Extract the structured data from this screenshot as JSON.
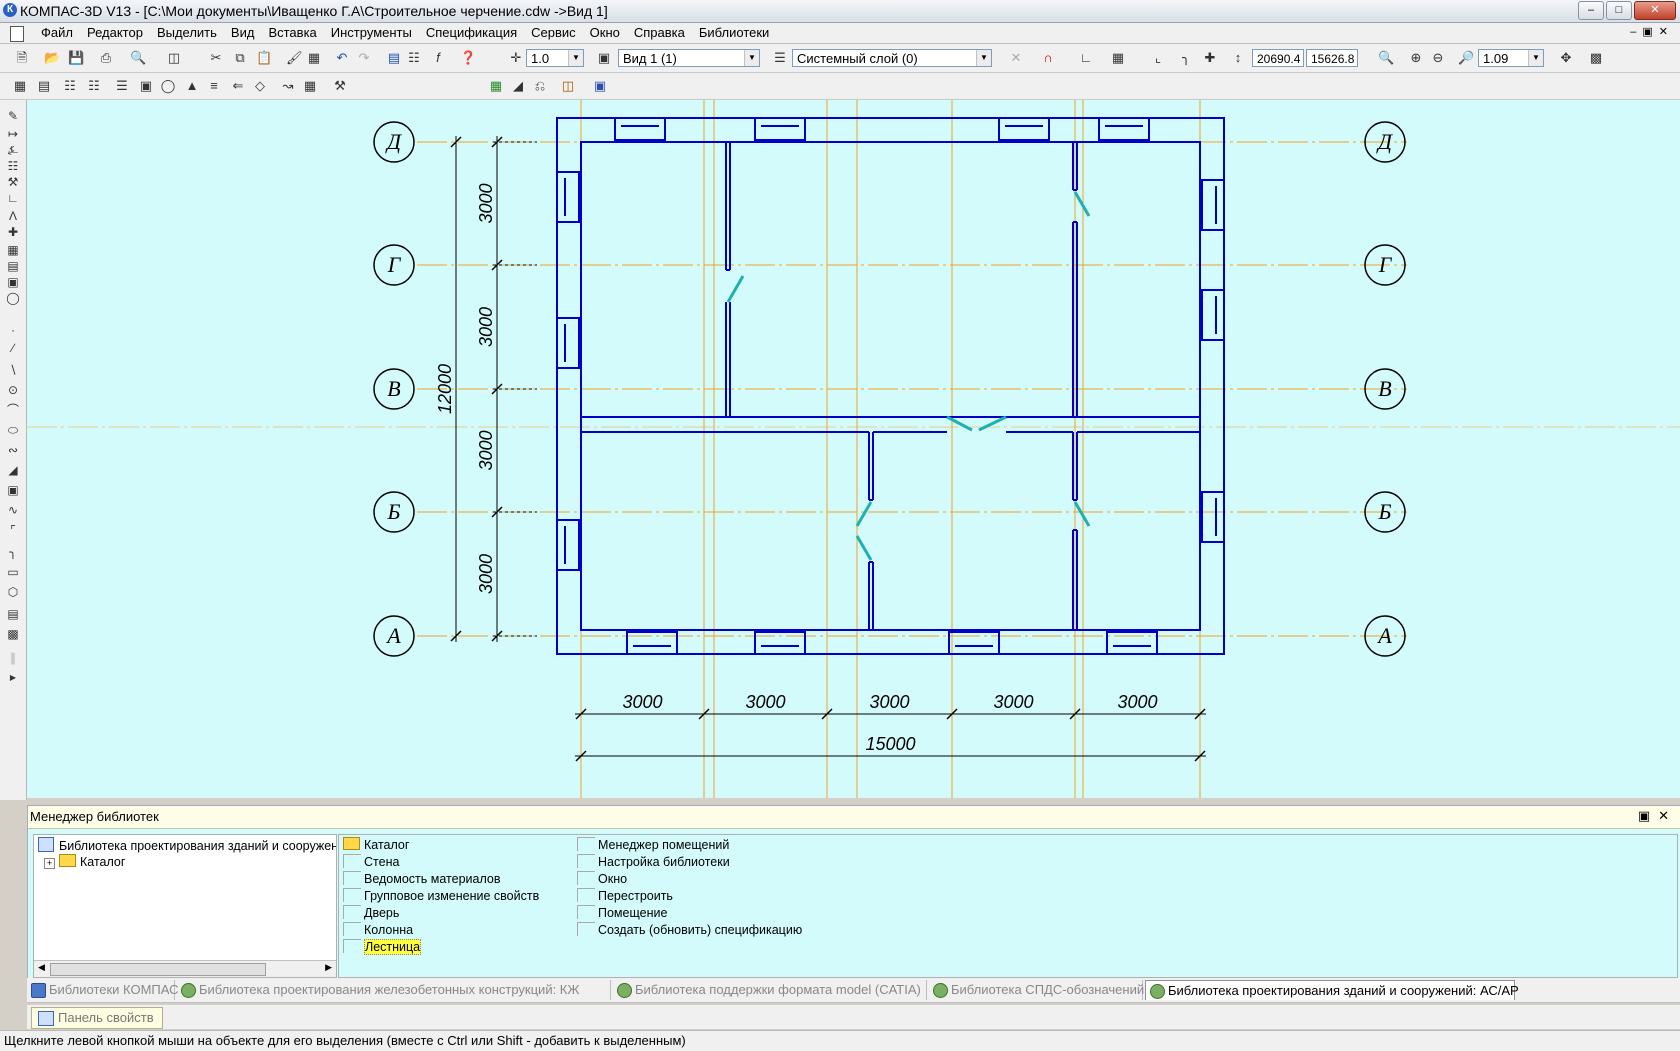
{
  "window": {
    "title": "КОМПАС-3D V13 - [C:\\Мои документы\\Иващенко Г.А\\Строительное черчение.cdw ->Вид 1]",
    "app_icon_label": "К"
  },
  "menu": [
    "Файл",
    "Редактор",
    "Выделить",
    "Вид",
    "Вставка",
    "Инструменты",
    "Спецификация",
    "Сервис",
    "Окно",
    "Справка",
    "Библиотеки"
  ],
  "toolbar": {
    "scale_value": "1.0",
    "view_value": "Вид 1 (1)",
    "layer_value": "Системный слой (0)",
    "coord_x": "20690.4",
    "coord_y": "15626.8",
    "zoom_value": "1.09"
  },
  "drawing": {
    "axis_letters": [
      "Д",
      "Г",
      "В",
      "Б",
      "А"
    ],
    "vertical_dims": [
      "3000",
      "3000",
      "3000",
      "3000"
    ],
    "vertical_total": "12000",
    "horizontal_dims": [
      "3000",
      "3000",
      "3000",
      "3000",
      "3000"
    ],
    "horizontal_total": "15000",
    "colors": {
      "background": "#d4fbfb",
      "wall": "#0000c8",
      "axis_line": "#f0a020",
      "door": "#20b0b0",
      "dim": "#000000"
    }
  },
  "library_manager": {
    "title": "Менеджер библиотек",
    "tree_root": "Библиотека проектирования зданий и сооружений: АС/АР",
    "tree_child": "Каталог",
    "list_col1": [
      "Каталог",
      "Стена",
      "Ведомость материалов",
      "Групповое изменение свойств",
      "Дверь",
      "Колонна",
      "Лестница"
    ],
    "list_col2": [
      "Менеджер помещений",
      "Настройка библиотеки",
      "Окно",
      "Перестроить",
      "Помещение",
      "Создать (обновить) спецификацию"
    ],
    "selected_item": "Лестница"
  },
  "tabs": [
    {
      "label": "Библиотеки КОМПАС",
      "active": false
    },
    {
      "label": "Библиотека проектирования железобетонных конструкций: КЖ",
      "active": false
    },
    {
      "label": "Библиотека поддержки формата model (CATIA)",
      "active": false
    },
    {
      "label": "Библиотека СПДС-обозначений",
      "active": false
    },
    {
      "label": "Библиотека проектирования зданий и сооружений: АС/АР",
      "active": true
    }
  ],
  "property_panel": "Панель свойств",
  "status": "Щелкните левой кнопкой мыши на объекте для его выделения (вместе с Ctrl или Shift - добавить к выделенным)"
}
